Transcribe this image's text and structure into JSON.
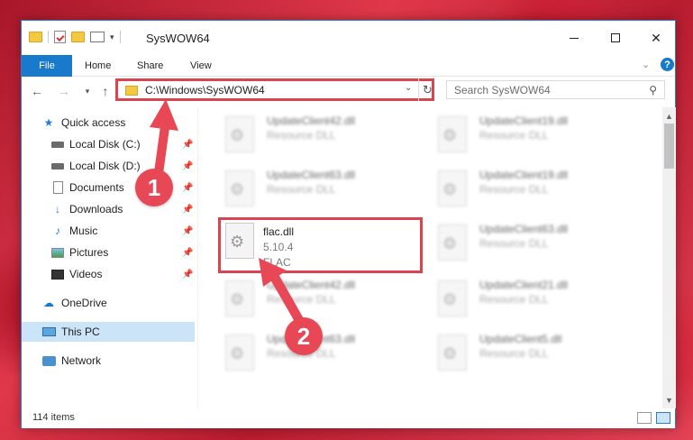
{
  "window": {
    "title": "SysWOW64"
  },
  "ribbon": {
    "tabs": [
      {
        "label": "File"
      },
      {
        "label": "Home"
      },
      {
        "label": "Share"
      },
      {
        "label": "View"
      }
    ],
    "help_label": "?"
  },
  "navbar": {
    "address": "C:\\Windows\\SysWOW64",
    "search_placeholder": "Search SysWOW64"
  },
  "sidebar": {
    "items": [
      {
        "label": "Quick access",
        "icon": "star-icon",
        "pinned": false
      },
      {
        "label": "Local Disk (C:)",
        "icon": "drive-icon",
        "pinned": true
      },
      {
        "label": "Local Disk (D:)",
        "icon": "drive-icon",
        "pinned": true
      },
      {
        "label": "Documents",
        "icon": "documents-icon",
        "pinned": true
      },
      {
        "label": "Downloads",
        "icon": "download-icon",
        "pinned": true
      },
      {
        "label": "Music",
        "icon": "music-icon",
        "pinned": true
      },
      {
        "label": "Pictures",
        "icon": "pictures-icon",
        "pinned": true
      },
      {
        "label": "Videos",
        "icon": "videos-icon",
        "pinned": true
      },
      {
        "label": "OneDrive",
        "icon": "cloud-icon",
        "pinned": false
      },
      {
        "label": "This PC",
        "icon": "computer-icon",
        "pinned": false,
        "selected": true
      },
      {
        "label": "Network",
        "icon": "network-icon",
        "pinned": false
      }
    ]
  },
  "files": [
    {
      "name": "UpdateClient42.dll",
      "desc": "Resource DLL"
    },
    {
      "name": "UpdateClient19.dll",
      "desc": "Resource DLL"
    },
    {
      "name": "UpdateClient63.dll",
      "desc": "Resource DLL"
    },
    {
      "name": "UpdateClient19.dll",
      "desc": "Resource DLL"
    },
    {
      "name": "flac.dll",
      "version": "5.10.4",
      "desc": "FLAC",
      "highlighted": true
    },
    {
      "name": "UpdateClient63.dll",
      "desc": "Resource DLL"
    },
    {
      "name": "UpdateClient42.dll",
      "desc": "Resource DLL"
    },
    {
      "name": "UpdateClient21.dll",
      "desc": "Resource DLL"
    },
    {
      "name": "UpdateClient63.dll",
      "desc": "Resource DLL"
    },
    {
      "name": "UpdateClient5.dll",
      "desc": "Resource DLL"
    }
  ],
  "status": {
    "item_count": "114 items"
  },
  "callouts": {
    "step1": "1",
    "step2": "2"
  },
  "colors": {
    "accent": "#1979ca",
    "highlight_border": "#d9454e",
    "callout": "#e84856",
    "selection": "#cce4f7"
  }
}
